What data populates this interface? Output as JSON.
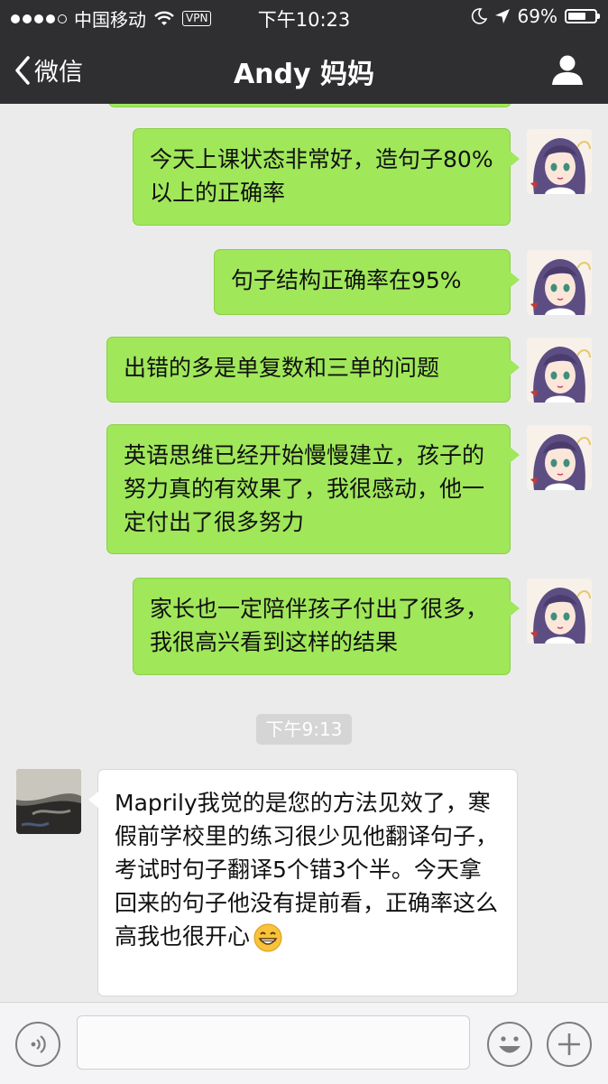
{
  "status_bar": {
    "carrier": "中国移动",
    "vpn": "VPN",
    "time": "下午10:23",
    "battery_percent": "69%",
    "battery_level": 0.69
  },
  "nav": {
    "back_label": "微信",
    "title": "Andy 妈妈"
  },
  "messages": {
    "out_1": "今天上课状态非常好，造句子80%以上的正确率",
    "out_2": "句子结构正确率在95%",
    "out_3": "出错的多是单复数和三单的问题",
    "out_4": "英语思维已经开始慢慢建立，孩子的努力真的有效果了，我很感动，他一定付出了很多努力",
    "out_5": "家长也一定陪伴孩子付出了很多，我很高兴看到这样的结果",
    "timestamp": "下午9:13",
    "in_1": "Maprily我觉的是您的方法见效了，寒假前学校里的练习很少见他翻译句子，考试时句子翻译5个错3个半。今天拿回来的句子他没有提前看，正确率这么高我也很开心"
  },
  "input": {
    "value": "",
    "placeholder": ""
  },
  "colors": {
    "bar": "#2f2f32",
    "bubble_out": "#a0e75a",
    "bubble_in": "#ffffff",
    "chat_bg": "#ebebeb"
  },
  "icons": [
    "back-chevron-icon",
    "person-icon",
    "wifi-icon",
    "moon-icon",
    "location-arrow-icon",
    "battery-icon",
    "voice-icon",
    "emoji-icon",
    "plus-icon",
    "grin-emoji-icon"
  ]
}
